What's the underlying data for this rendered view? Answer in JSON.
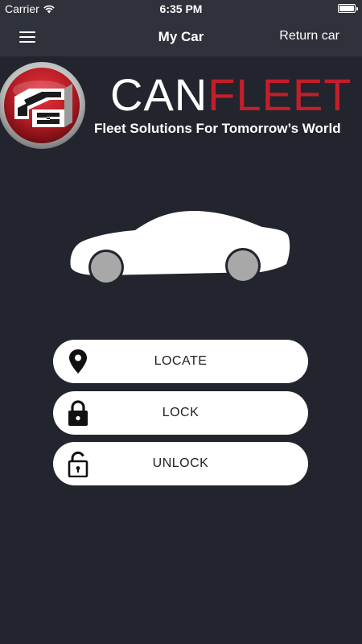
{
  "status_bar": {
    "carrier": "Carrier",
    "time": "6:35 PM",
    "wifi_icon": "wifi-icon",
    "battery_icon": "battery-icon"
  },
  "nav": {
    "menu_icon": "hamburger-menu-icon",
    "title": "My Car",
    "return_label": "Return car"
  },
  "brand": {
    "name_part1": "CAN",
    "name_part2": "FLEET",
    "tagline": "Fleet Solutions For Tomorrow’s World",
    "accent_color": "#c41e2a"
  },
  "actions": [
    {
      "label": "LOCATE",
      "icon": "location-pin-icon"
    },
    {
      "label": "LOCK",
      "icon": "lock-closed-icon"
    },
    {
      "label": "UNLOCK",
      "icon": "lock-open-icon"
    }
  ],
  "colors": {
    "background": "#22252d",
    "bar": "#2f323a",
    "button": "#ffffff"
  }
}
